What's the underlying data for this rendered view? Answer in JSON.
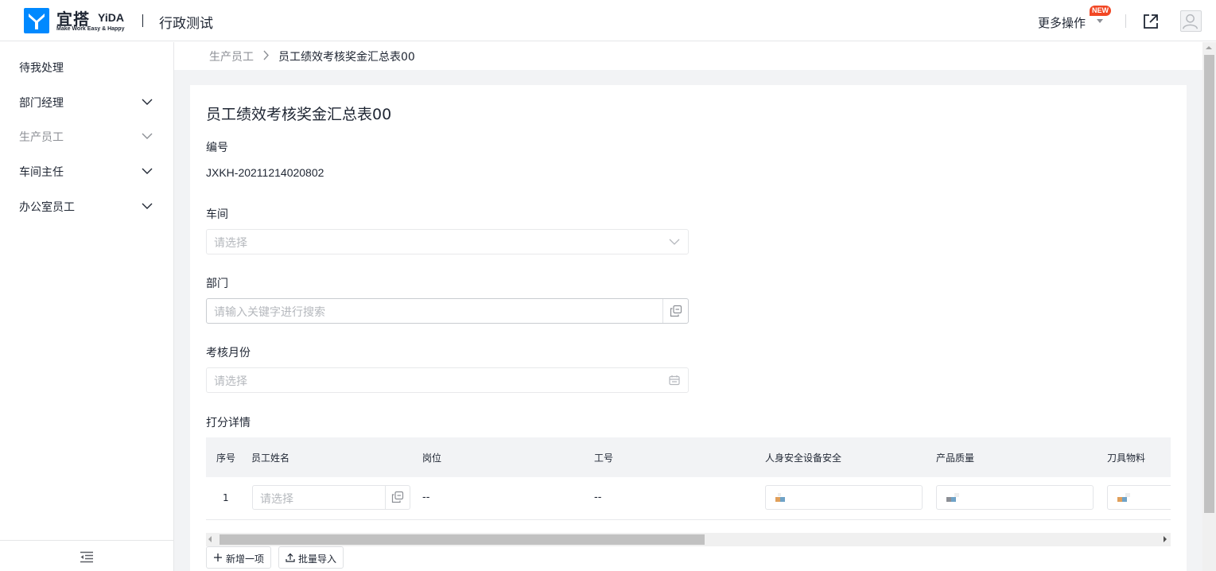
{
  "header": {
    "logo_cn": "宜搭",
    "logo_en": "YiDA",
    "logo_slogan": "Make Work Easy & Happy",
    "app_title": "行政测试",
    "more_ops_label": "更多操作",
    "new_badge": "NEW",
    "accent_color": "#0089ff",
    "badge_color": "#f24724"
  },
  "sidebar": {
    "items": [
      {
        "label": "待我处理",
        "icon": null
      },
      {
        "label": "部门经理",
        "icon": "chevron-down-icon"
      },
      {
        "label": "生产员工",
        "icon": "chevron-down-icon"
      },
      {
        "label": "车间主任",
        "icon": "chevron-down-icon"
      },
      {
        "label": "办公室员工",
        "icon": "chevron-down-icon"
      }
    ],
    "collapse_icon": "collapse-menu-icon"
  },
  "breadcrumb": {
    "parent": "生产员工",
    "current": "员工绩效考核奖金汇总表00"
  },
  "form": {
    "title": "员工绩效考核奖金汇总表00",
    "serial": {
      "label": "编号",
      "value": "JXKH-20211214020802"
    },
    "workshop": {
      "label": "车间",
      "placeholder": "请选择"
    },
    "department": {
      "label": "部门",
      "placeholder": "请输入关键字进行搜索"
    },
    "month": {
      "label": "考核月份",
      "placeholder": "请选择"
    },
    "details": {
      "label": "打分详情",
      "columns": [
        "序号",
        "员工姓名",
        "岗位",
        "工号",
        "人身安全设备安全",
        "产品质量",
        "刀具物料"
      ],
      "rows": [
        {
          "index": "1",
          "name_placeholder": "请选择",
          "position": "--",
          "employee_no": "--"
        }
      ]
    },
    "add_button": "新增一项",
    "import_button": "批量导入"
  }
}
